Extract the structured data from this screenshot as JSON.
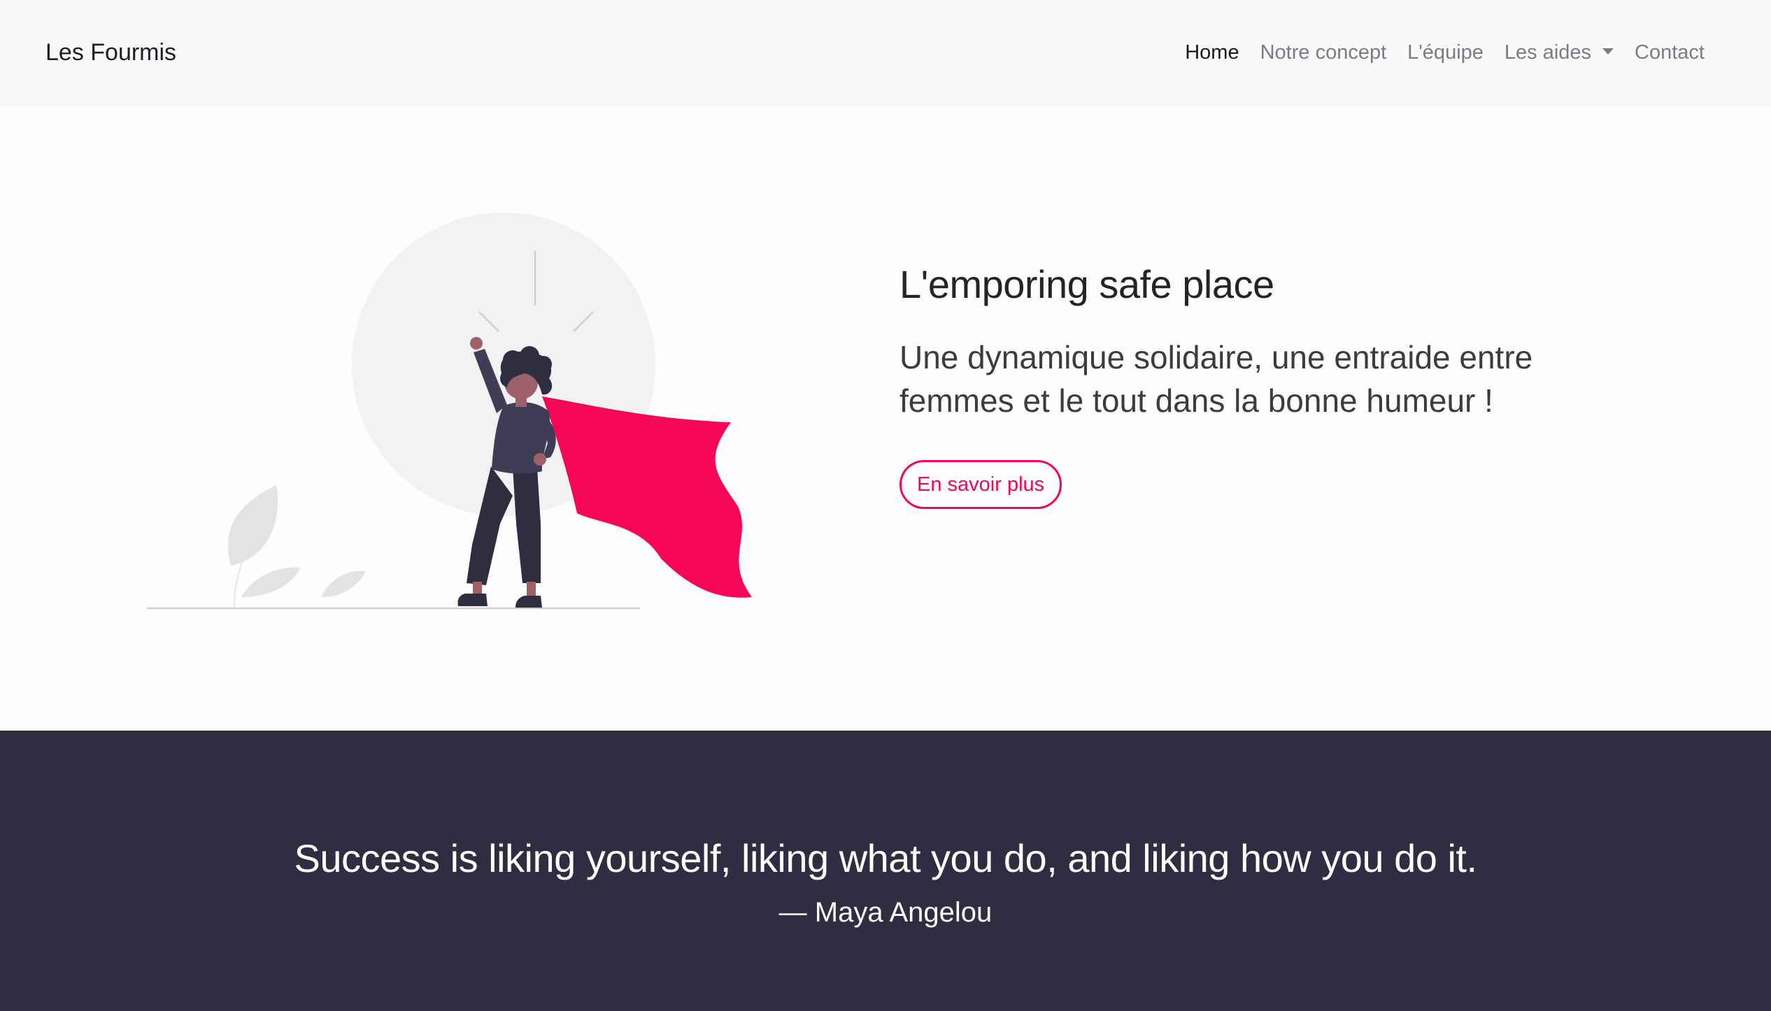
{
  "navbar": {
    "brand": "Les Fourmis",
    "links": [
      {
        "label": "Home",
        "active": true
      },
      {
        "label": "Notre concept"
      },
      {
        "label": "L'équipe"
      },
      {
        "label": "Les aides",
        "dropdown": true
      },
      {
        "label": "Contact"
      }
    ]
  },
  "hero": {
    "title": "L'emporing safe place",
    "text": "Une dynamique solidaire, une entraide entre femmes et le tout dans la bonne humeur !",
    "button_label": "En savoir plus",
    "illustration_icon": "superhero-woman-cape-illustration"
  },
  "quote": {
    "text": "Success is liking yourself, liking what you do, and liking how you do it.",
    "author": "— Maya Angelou"
  },
  "colors": {
    "accent": "#f4045a",
    "dark": "#2e2d41",
    "navbar_bg": "#f8f9fb"
  }
}
